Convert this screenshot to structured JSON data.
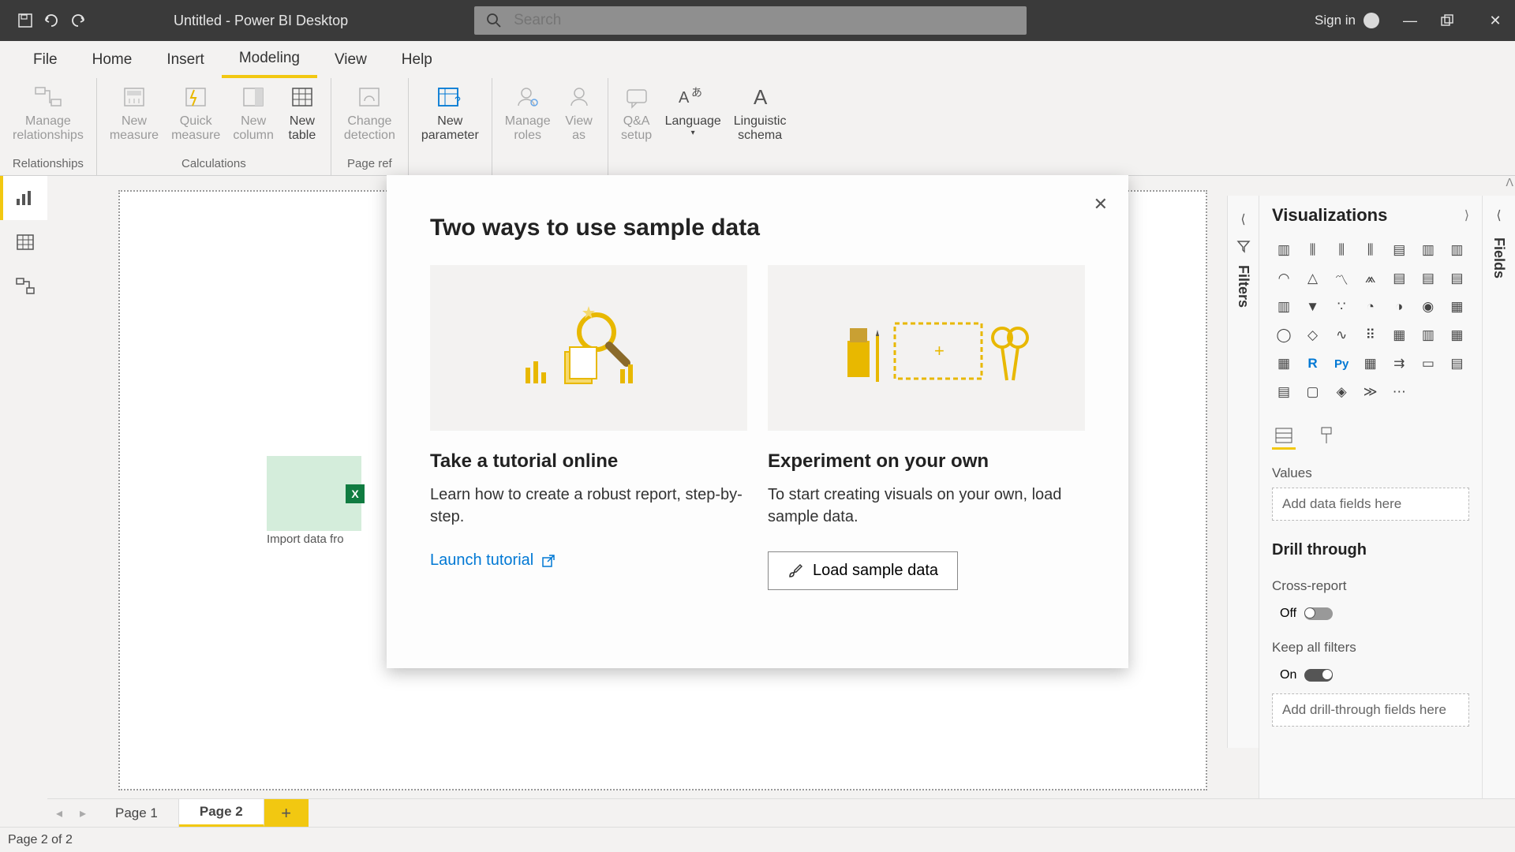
{
  "titlebar": {
    "title": "Untitled - Power BI Desktop",
    "search_placeholder": "Search",
    "signin": "Sign in"
  },
  "menubar": {
    "file": "File",
    "home": "Home",
    "insert": "Insert",
    "modeling": "Modeling",
    "view": "View",
    "help": "Help"
  },
  "ribbon": {
    "groups": {
      "relationships": {
        "label": "Relationships",
        "manage": "Manage\nrelationships"
      },
      "calculations": {
        "label": "Calculations",
        "new_measure": "New\nmeasure",
        "quick_measure": "Quick\nmeasure",
        "new_column": "New\ncolumn",
        "new_table": "New\ntable"
      },
      "page_refresh": {
        "label": "Page ref",
        "change_detection": "Change\ndetection"
      },
      "whatif": {
        "new_parameter": "New\nparameter"
      },
      "security": {
        "manage_roles": "Manage\nroles",
        "view_as": "View\nas"
      },
      "qa": {
        "qa_setup": "Q&A\nsetup",
        "language": "Language",
        "linguistic": "Linguistic\nschema"
      }
    }
  },
  "canvas": {
    "hint_label": "Import data fro"
  },
  "dialog": {
    "title": "Two ways to use sample data",
    "left": {
      "heading": "Take a tutorial online",
      "desc": "Learn how to create a robust report, step-by-step.",
      "link": "Launch tutorial"
    },
    "right": {
      "heading": "Experiment on your own",
      "desc": "To start creating visuals on your own, load sample data.",
      "button": "Load sample data"
    }
  },
  "filters": {
    "label": "Filters"
  },
  "vizpane": {
    "title": "Visualizations",
    "values_label": "Values",
    "values_placeholder": "Add data fields here",
    "drill_heading": "Drill through",
    "cross_report": "Cross-report",
    "cross_report_state": "Off",
    "keep_all": "Keep all filters",
    "keep_all_state": "On",
    "drill_placeholder": "Add drill-through fields here"
  },
  "fields": {
    "label": "Fields"
  },
  "pagetabs": {
    "page1": "Page 1",
    "page2": "Page 2"
  },
  "statusbar": {
    "text": "Page 2 of 2"
  }
}
